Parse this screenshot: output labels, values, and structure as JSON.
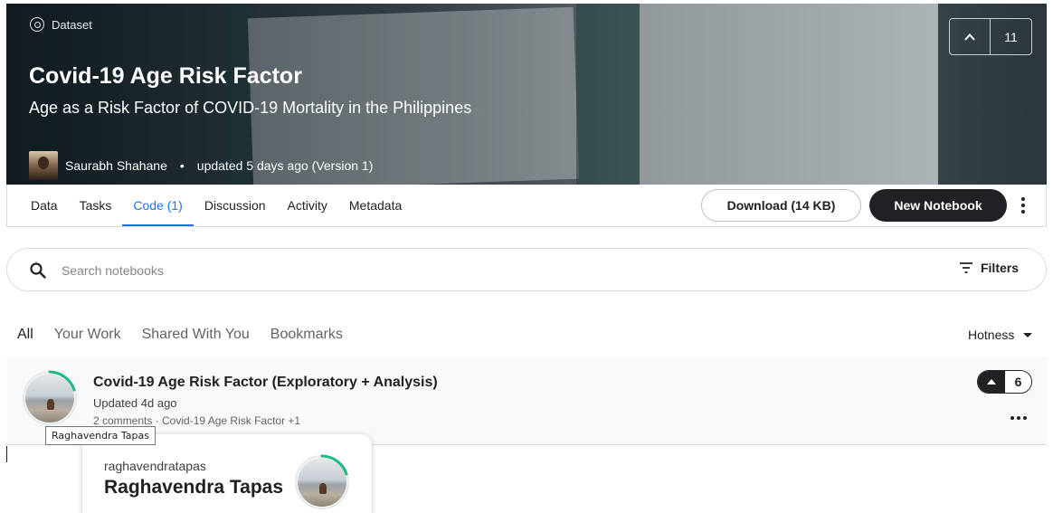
{
  "header": {
    "tag": "Dataset",
    "title": "Covid-19 Age Risk Factor",
    "subtitle": "Age as a Risk Factor of COVID-19 Mortality in the Philippines",
    "author": "Saurabh Shahane",
    "updated": "updated 5 days ago (Version 1)",
    "upvotes": "11"
  },
  "tabs": [
    "Data",
    "Tasks",
    "Code (1)",
    "Discussion",
    "Activity",
    "Metadata"
  ],
  "active_tab": "Code (1)",
  "actions": {
    "download_label": "Download (14 KB)",
    "new_notebook_label": "New Notebook"
  },
  "search": {
    "placeholder": "Search notebooks",
    "filters_label": "Filters"
  },
  "filter_tabs": [
    "All",
    "Your Work",
    "Shared With You",
    "Bookmarks"
  ],
  "sort": {
    "label": "Hotness"
  },
  "notebook": {
    "title": "Covid-19 Age Risk Factor (Exploratory + Analysis)",
    "updated": "Updated 4d ago",
    "meta": "2 comments · Covid-19 Age Risk Factor +1",
    "votes": "6"
  },
  "tooltip": "Raghavendra Tapas",
  "hovercard": {
    "username": "raghavendratapas",
    "display_name": "Raghavendra Tapas"
  },
  "colors": {
    "accent": "#1a73e8",
    "progress_ring": "#20beff",
    "tier_ring": "#1eb980",
    "dark_button": "#202124"
  }
}
